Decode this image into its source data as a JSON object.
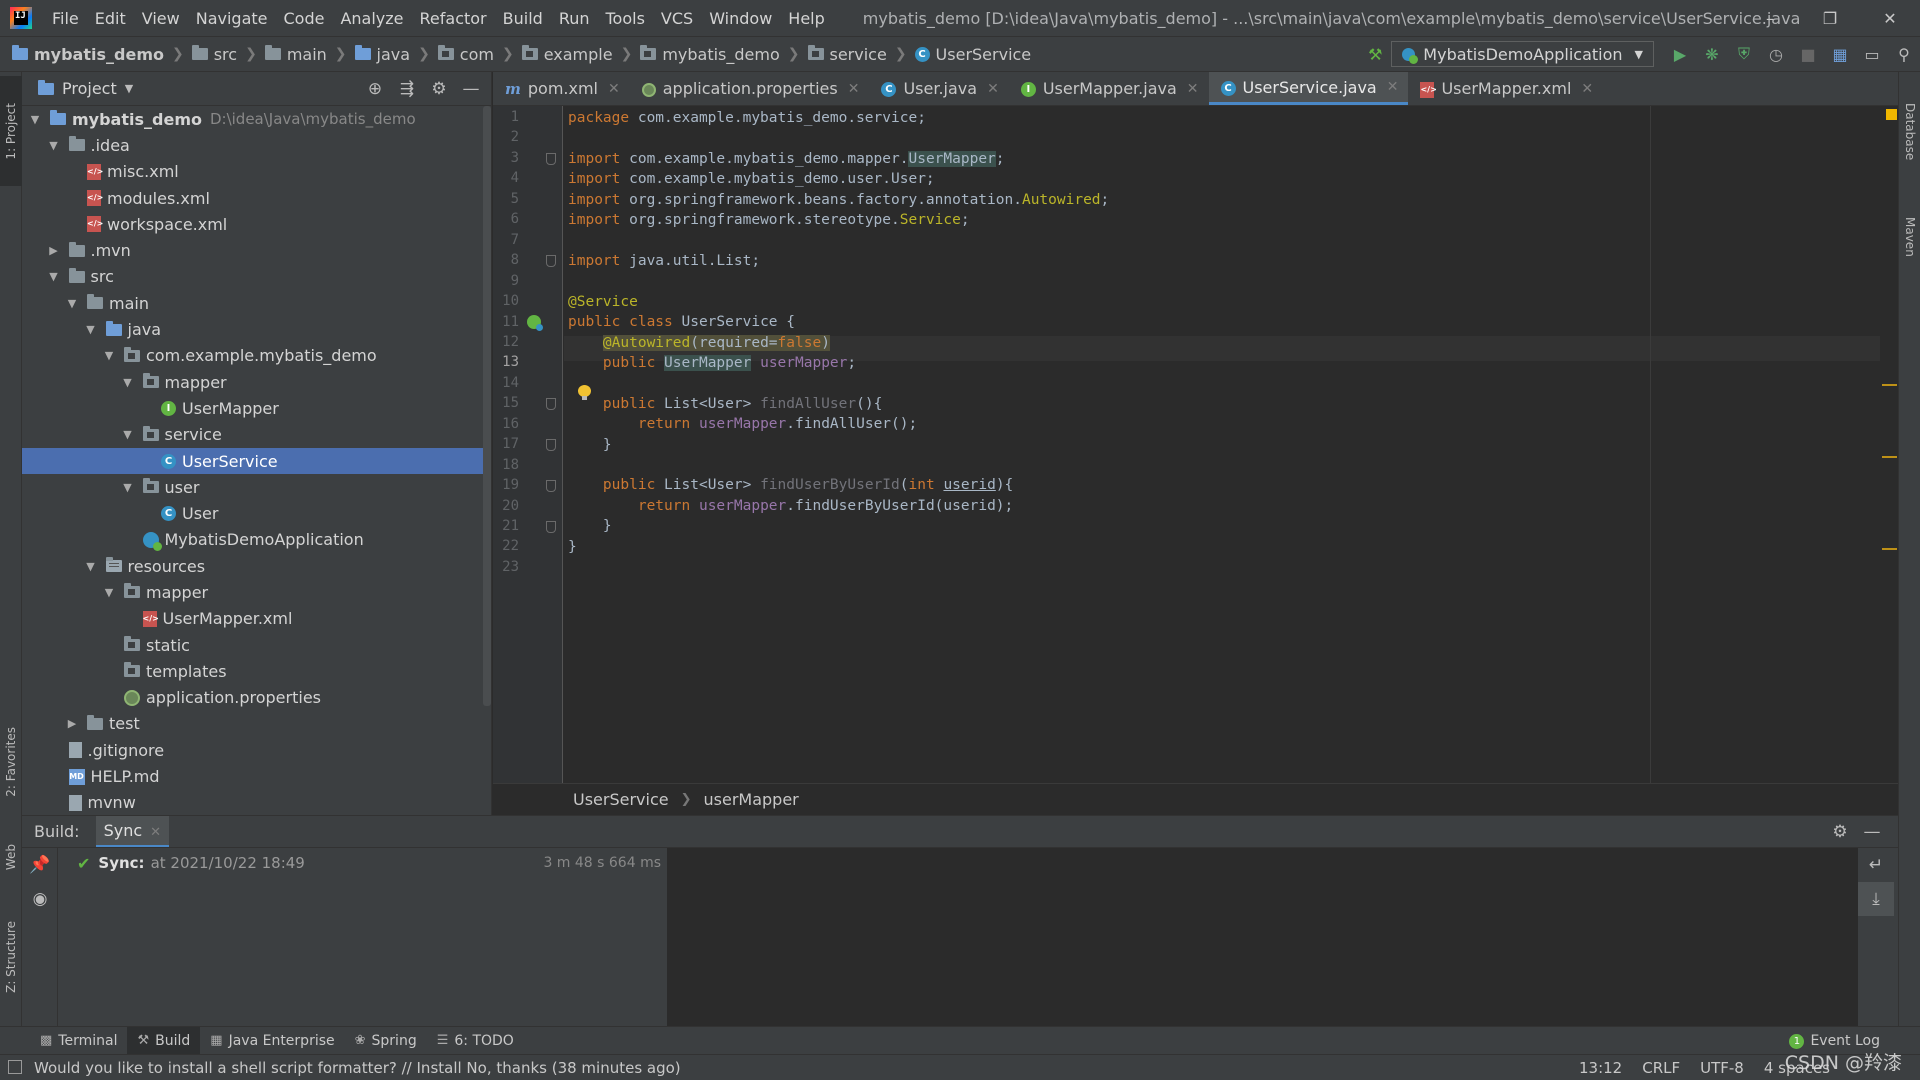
{
  "menubar": {
    "items": [
      "File",
      "Edit",
      "View",
      "Navigate",
      "Code",
      "Analyze",
      "Refactor",
      "Build",
      "Run",
      "Tools",
      "VCS",
      "Window",
      "Help"
    ],
    "title": "mybatis_demo [D:\\idea\\Java\\mybatis_demo] - ...\\src\\main\\java\\com\\example\\mybatis_demo\\service\\UserService.java",
    "logo_text": "IJ"
  },
  "navbar": {
    "crumbs": [
      "mybatis_demo",
      "src",
      "main",
      "java",
      "com",
      "example",
      "mybatis_demo",
      "service",
      "UserService"
    ],
    "run_config": "MybatisDemoApplication"
  },
  "project_panel": {
    "title": "Project",
    "tree": [
      {
        "label": "mybatis_demo",
        "path": "D:\\idea\\Java\\mybatis_demo",
        "icon": "module-folder-icon",
        "depth": 0,
        "expanded": true,
        "bold": true
      },
      {
        "label": ".idea",
        "icon": "folder-icon",
        "depth": 1,
        "expanded": true
      },
      {
        "label": "misc.xml",
        "icon": "xml-file-icon",
        "depth": 2
      },
      {
        "label": "modules.xml",
        "icon": "xml-file-icon",
        "depth": 2
      },
      {
        "label": "workspace.xml",
        "icon": "xml-file-icon",
        "depth": 2
      },
      {
        "label": ".mvn",
        "icon": "folder-icon",
        "depth": 1,
        "expanded": false
      },
      {
        "label": "src",
        "icon": "folder-icon",
        "depth": 1,
        "expanded": true
      },
      {
        "label": "main",
        "icon": "folder-icon",
        "depth": 2,
        "expanded": true
      },
      {
        "label": "java",
        "icon": "source-folder-icon",
        "depth": 3,
        "expanded": true
      },
      {
        "label": "com.example.mybatis_demo",
        "icon": "package-icon",
        "depth": 4,
        "expanded": true
      },
      {
        "label": "mapper",
        "icon": "package-icon",
        "depth": 5,
        "expanded": true
      },
      {
        "label": "UserMapper",
        "icon": "interface-icon",
        "depth": 6
      },
      {
        "label": "service",
        "icon": "package-icon",
        "depth": 5,
        "expanded": true
      },
      {
        "label": "UserService",
        "icon": "class-icon",
        "depth": 6,
        "selected": true
      },
      {
        "label": "user",
        "icon": "package-icon",
        "depth": 5,
        "expanded": true
      },
      {
        "label": "User",
        "icon": "class-icon",
        "depth": 6
      },
      {
        "label": "MybatisDemoApplication",
        "icon": "spring-boot-app-icon",
        "depth": 5
      },
      {
        "label": "resources",
        "icon": "resources-folder-icon",
        "depth": 3,
        "expanded": true
      },
      {
        "label": "mapper",
        "icon": "package-icon",
        "depth": 4,
        "expanded": true
      },
      {
        "label": "UserMapper.xml",
        "icon": "xml-file-icon",
        "depth": 5
      },
      {
        "label": "static",
        "icon": "package-icon",
        "depth": 4
      },
      {
        "label": "templates",
        "icon": "package-icon",
        "depth": 4
      },
      {
        "label": "application.properties",
        "icon": "properties-file-icon",
        "depth": 4
      },
      {
        "label": "test",
        "icon": "folder-icon",
        "depth": 2,
        "expanded": false
      },
      {
        "label": ".gitignore",
        "icon": "text-file-icon",
        "depth": 1
      },
      {
        "label": "HELP.md",
        "icon": "markdown-file-icon",
        "depth": 1
      },
      {
        "label": "mvnw",
        "icon": "script-file-icon",
        "depth": 1
      }
    ]
  },
  "editor": {
    "tabs": [
      {
        "label": "pom.xml",
        "icon": "maven-icon",
        "active": false
      },
      {
        "label": "application.properties",
        "icon": "properties-file-icon",
        "active": false
      },
      {
        "label": "User.java",
        "icon": "class-icon",
        "active": false
      },
      {
        "label": "UserMapper.java",
        "icon": "interface-icon",
        "active": false
      },
      {
        "label": "UserService.java",
        "icon": "class-icon",
        "active": true
      },
      {
        "label": "UserMapper.xml",
        "icon": "xml-file-icon",
        "active": false
      }
    ],
    "current_line": "13",
    "line_numbers": [
      "1",
      "2",
      "3",
      "4",
      "5",
      "6",
      "7",
      "8",
      "9",
      "10",
      "11",
      "12",
      "13",
      "14",
      "15",
      "16",
      "17",
      "18",
      "19",
      "20",
      "21",
      "22",
      "23"
    ],
    "code": {
      "l1_kw": "package",
      "l1_rest": " com.example.mybatis_demo.service;",
      "l3_kw": "import",
      "l3_pre": " com.example.mybatis_demo.mapper.",
      "l3_ref": "UserMapper",
      "l3_end": ";",
      "l4_kw": "import",
      "l4_rest": " com.example.mybatis_demo.user.User;",
      "l5_kw": "import",
      "l5_pre": " org.springframework.beans.factory.annotation.",
      "l5_ref": "Autowired",
      "l5_end": ";",
      "l6_kw": "import",
      "l6_pre": " org.springframework.stereotype.",
      "l6_ref": "Service",
      "l6_end": ";",
      "l8_kw": "import",
      "l8_rest": " java.util.List;",
      "l10_ann": "@Service",
      "l11_kw": "public class",
      "l11_rest": " UserService {",
      "l12_ann": "@Autowired",
      "l12_open": "(required=",
      "l12_false": "false",
      "l12_close": ")",
      "l13_kw": "public",
      "l13_type": "UserMapper",
      "l13_field": "userMapper",
      "l13_end": ";",
      "l15_kw": "public",
      "l15_type": " List<User> ",
      "l15_method": "findAllUser",
      "l15_end": "(){",
      "l16_kw": "return",
      "l16_field": "userMapper",
      "l16_rest": ".findAllUser();",
      "l17": "}",
      "l19_kw": "public",
      "l19_type": " List<User> ",
      "l19_method": "findUserByUserId",
      "l19_open": "(",
      "l19_int": "int",
      "l19_param": "userid",
      "l19_end": "){",
      "l20_kw": "return",
      "l20_field": "userMapper",
      "l20_rest": ".findUserByUserId(userid);",
      "l21": "}",
      "l22": "}"
    },
    "breadcrumb": [
      "UserService",
      "userMapper"
    ]
  },
  "build_panel": {
    "label": "Build:",
    "tab": "Sync",
    "row": {
      "title": "Sync:",
      "at": "at 2021/10/22 18:49",
      "duration": "3 m 48 s 664 ms"
    }
  },
  "tool_tabs": [
    {
      "label": "Terminal",
      "icon": "terminal-icon"
    },
    {
      "label": "Build",
      "icon": "hammer-icon",
      "active": true
    },
    {
      "label": "Java Enterprise",
      "icon": "java-enterprise-icon"
    },
    {
      "label": "Spring",
      "icon": "spring-icon"
    },
    {
      "label": "6: TODO",
      "icon": "todo-icon"
    }
  ],
  "event_log": {
    "label": "Event Log",
    "count": "1"
  },
  "sidebar_tabs": {
    "project": "1: Project",
    "favorites": "2: Favorites",
    "web": "Web",
    "structure": "Z: Structure",
    "database": "Database",
    "maven": "Maven"
  },
  "statusbar": {
    "message": "Would you like to install a shell script formatter? // Install   No, thanks (38 minutes ago)",
    "position": "13:12",
    "line_sep": "CRLF",
    "encoding": "UTF-8",
    "indent": "4 spaces"
  },
  "watermark": "CSDN @羚漆",
  "colors": {
    "keyword": "#cc7832",
    "annotation": "#bbb529",
    "field": "#9876aa",
    "selection": "#4b6eaf",
    "accent_tab": "#4a88c7"
  }
}
